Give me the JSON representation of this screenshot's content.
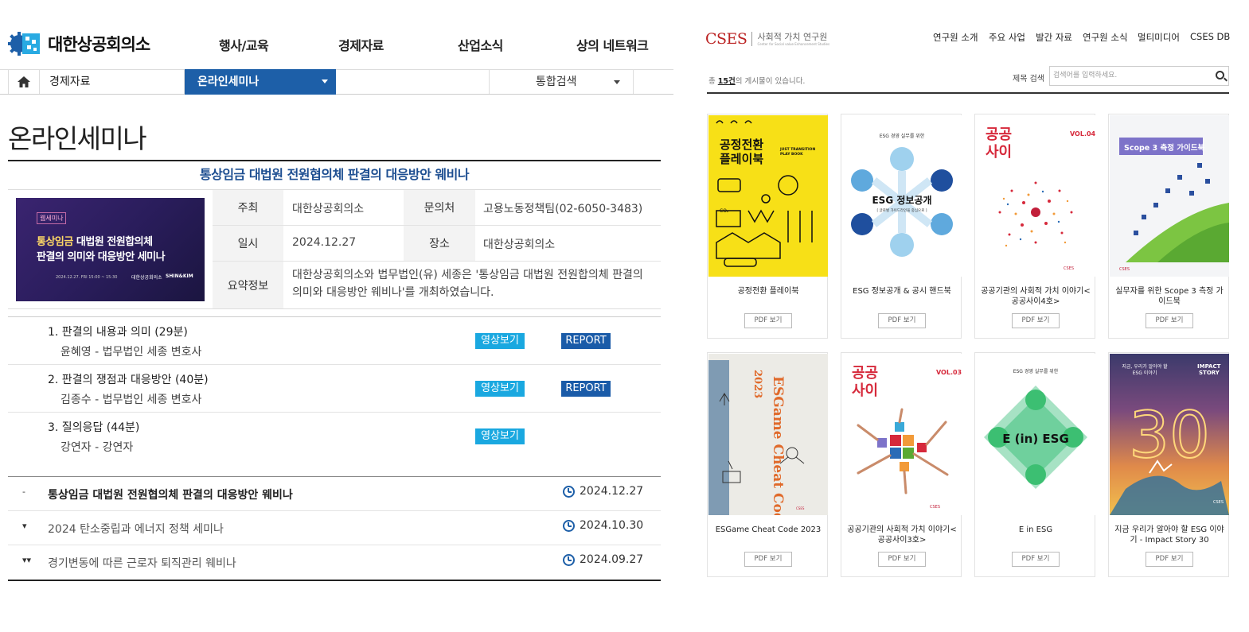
{
  "kcci": {
    "logo_text": "대한상공회의소",
    "nav": [
      "행사/교육",
      "경제자료",
      "산업소식",
      "상의 네트워크"
    ],
    "breadcrumb": {
      "level1": "경제자료",
      "level2": "온라인세미나",
      "search": "통합검색"
    },
    "page_title": "온라인세미나",
    "seminar": {
      "title": "통상임금 대법원 전원협의체 판결의 대응방안 웨비나",
      "thumb": {
        "tag": "웹세미나",
        "line1_highlight": "통상임금",
        "line1": " 대법원 전원합의체",
        "line2": "판결의 의미와 대응방안 세미나",
        "footer": "2024.12.27. FRI 15:00 ~ 15:30",
        "org1": "대한상공회의소",
        "org2": "SHIN&KIM"
      },
      "host_label": "주최",
      "host": "대한상공회의소",
      "contact_label": "문의처",
      "contact": "고용노동정책팀(02-6050-3483)",
      "date_label": "일시",
      "date": "2024.12.27",
      "place_label": "장소",
      "place": "대한상공회의소",
      "summary_label": "요약정보",
      "summary_line1": "대한상공회의소와 법무법인(유) 세종은 '통상임금 대법원 전원합의체 판결의",
      "summary_line2": "의미와 대응방안 웨비나'를 개최하였습니다."
    },
    "sessions": [
      {
        "title": "1. 판결의 내용과 의미 (29분)",
        "speaker": "윤혜영 - 법무법인 세종 변호사",
        "video": "영상보기",
        "report": "REPORT"
      },
      {
        "title": "2. 판결의 쟁점과 대응방안 (40분)",
        "speaker": "김종수 - 법무법인 세종 변호사",
        "video": "영상보기",
        "report": "REPORT"
      },
      {
        "title": "3. 질의응답 (44분)",
        "speaker": "강연자 - 강연자",
        "video": "영상보기"
      }
    ],
    "list": [
      {
        "marker": "-",
        "title": "통상임금 대법원 전원협의체 판결의 대응방안 웨비나",
        "date": "2024.12.27"
      },
      {
        "marker": "▾",
        "title": "2024 탄소중립과 에너지 정책 세미나",
        "date": "2024.10.30"
      },
      {
        "marker": "▾▾",
        "title": "경기변동에 따른 근로자 퇴직관리 웨비나",
        "date": "2024.09.27"
      }
    ]
  },
  "cses": {
    "logo_word": "CSES",
    "logo_kor": "사회적 가치 연구원",
    "logo_eng": "Center for Social value Enhancement Studies",
    "nav": [
      "연구원 소개",
      "주요 사업",
      "발간 자료",
      "연구원 소식",
      "멀티미디어",
      "CSES DB"
    ],
    "count_prefix": "총 ",
    "count_value": "15건",
    "count_suffix": "의 게시물이 있습니다.",
    "search_label": "제목 검색",
    "search_placeholder": "검색어를 입력하세요.",
    "pdf_label": "PDF 보기",
    "books": [
      {
        "caption": "공정전환 플레이북",
        "cover_title": "공정전환\n플레이북",
        "cover_sub": "JUST TRANSITION PLAY BOOK"
      },
      {
        "caption": "ESG 정보공개 & 공시 핸드북",
        "cover_title": "ESG 정보공개",
        "cover_top": "ESG 경영 실무를 위한"
      },
      {
        "caption": "공공기관의 사회적 가치 이야기< 공공사이4호>",
        "cover_title": "공공\n사이",
        "cover_vol": "VOL.04"
      },
      {
        "caption": "실무자를 위한 Scope 3 측정 가이드북",
        "cover_title": "Scope 3 측정 가이드북"
      },
      {
        "caption": "ESGame Cheat Code 2023",
        "cover_title": "ESGame Cheat Code",
        "cover_year": "2023"
      },
      {
        "caption": "공공기관의 사회적 가치 이야기< 공공사이3호>",
        "cover_title": "공공\n사이",
        "cover_vol": "VOL.03"
      },
      {
        "caption": "E in ESG",
        "cover_title": "E (in) ESG",
        "cover_top": "ESG 경영 실무를 위한"
      },
      {
        "caption": "지금 우리가 알아야 할 ESG 이야기 - Impact Story 30",
        "cover_title": "IMPACT STORY",
        "cover_top": "지금, 우리가 알아야 할 ESG 이야기"
      }
    ]
  },
  "colors": {
    "kcci_blue": "#1d5fa8",
    "video_btn": "#1aa8e0",
    "cses_red": "#b22222"
  }
}
